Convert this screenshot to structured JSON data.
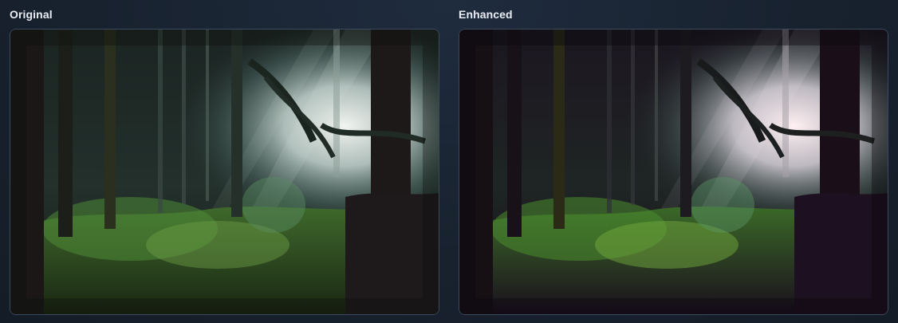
{
  "comparison": {
    "original": {
      "label": "Original",
      "image_icon": "forest-photo-original"
    },
    "enhanced": {
      "label": "Enhanced",
      "image_icon": "forest-photo-enhanced"
    }
  }
}
